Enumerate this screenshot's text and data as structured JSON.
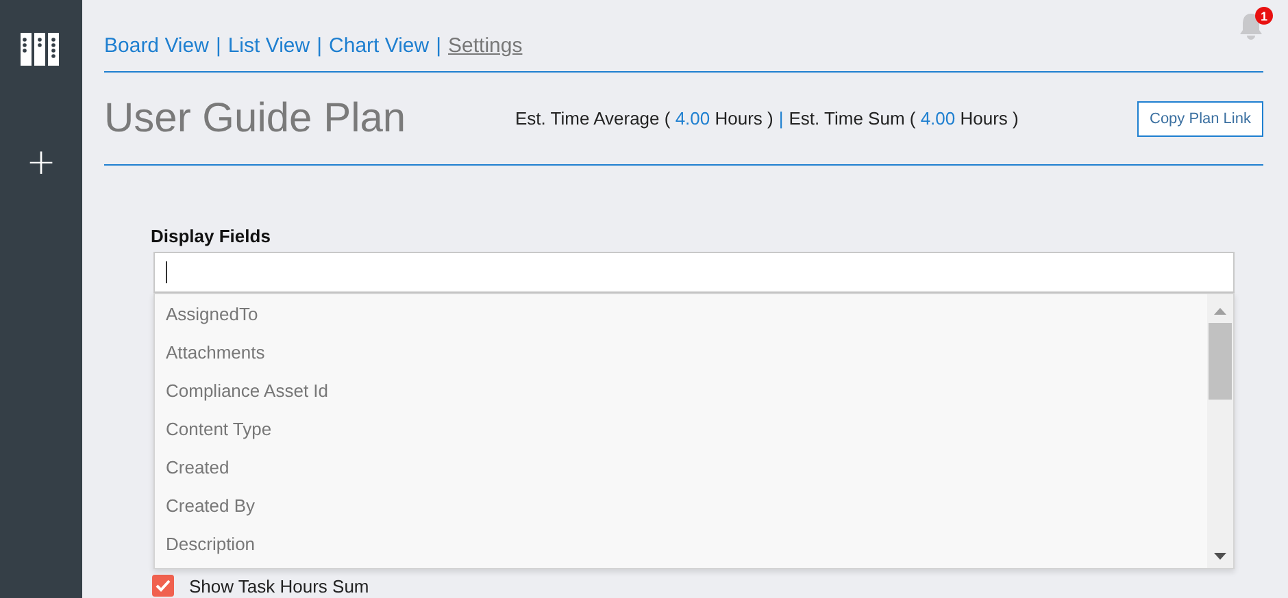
{
  "sidebar": {
    "items": [
      {
        "kind": "boards"
      },
      {
        "kind": "add",
        "label": "+"
      }
    ]
  },
  "nav": {
    "items": [
      {
        "label": "Board View",
        "selected": false
      },
      {
        "label": "List View",
        "selected": false
      },
      {
        "label": "Chart View",
        "selected": false
      },
      {
        "label": "Settings",
        "selected": true
      }
    ],
    "separators": [
      "|",
      "|",
      "|"
    ]
  },
  "notifications": {
    "count": "1"
  },
  "plan": {
    "title": "User Guide Plan",
    "stats": [
      {
        "prefix": "Est. Time Average (",
        "value": "4.00",
        "suffix": "Hours )"
      },
      {
        "prefix": "Est. Time Sum (",
        "value": "4.00",
        "suffix": "Hours )"
      }
    ],
    "stats_separator": "|",
    "copy_button": "Copy Plan Link"
  },
  "display_fields": {
    "label": "Display Fields",
    "options": [
      {
        "label": "AssignedTo"
      },
      {
        "label": "Attachments"
      },
      {
        "label": "Compliance Asset Id"
      },
      {
        "label": "Content Type"
      },
      {
        "label": "Created"
      },
      {
        "label": "Created By"
      },
      {
        "label": "Description"
      }
    ]
  },
  "options": [
    {
      "label": "Show Task Hours Sum",
      "checked": true
    }
  ]
}
